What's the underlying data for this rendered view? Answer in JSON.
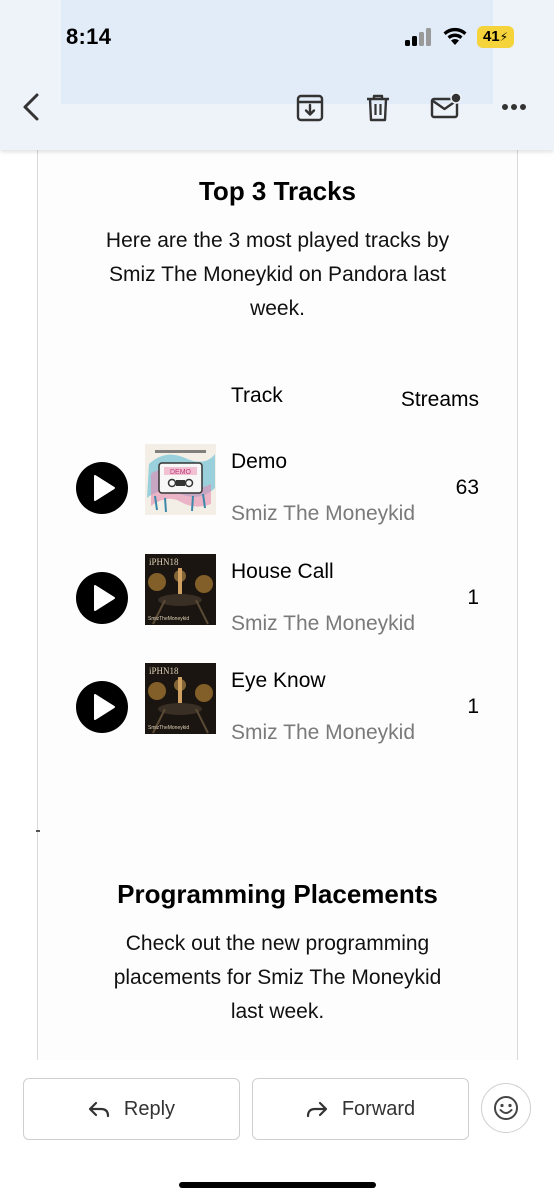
{
  "status_bar": {
    "time": "8:14",
    "battery": "41",
    "battery_color": "#f5d33a"
  },
  "toolbar": {
    "icons": [
      "back-icon",
      "archive-icon",
      "trash-icon",
      "mark-unread-icon",
      "more-icon"
    ]
  },
  "top_tracks": {
    "title": "Top 3 Tracks",
    "description_lines": [
      "Here are the 3 most played tracks by",
      "Smiz The Moneykid on Pandora last",
      "week."
    ],
    "col_track": "Track",
    "col_streams": "Streams",
    "tracks": [
      {
        "name": "Demo",
        "artist": "Smiz The Moneykid",
        "streams": "63",
        "cover": "demo-cassette"
      },
      {
        "name": "House Call",
        "artist": "Smiz The Moneykid",
        "streams": "1",
        "cover": "iphn18"
      },
      {
        "name": "Eye Know",
        "artist": "Smiz The Moneykid",
        "streams": "1",
        "cover": "iphn18"
      }
    ]
  },
  "programming": {
    "title": "Programming Placements",
    "description_lines": [
      "Check out the new programming",
      "placements for Smiz The Moneykid",
      "last week."
    ]
  },
  "actions": {
    "reply": "Reply",
    "forward": "Forward",
    "emoji": "emoji-reaction-icon"
  },
  "colors": {
    "toolbar_bg": "#eef3f9",
    "secondary_text": "#7a7a7a",
    "play_button": "#000000"
  }
}
